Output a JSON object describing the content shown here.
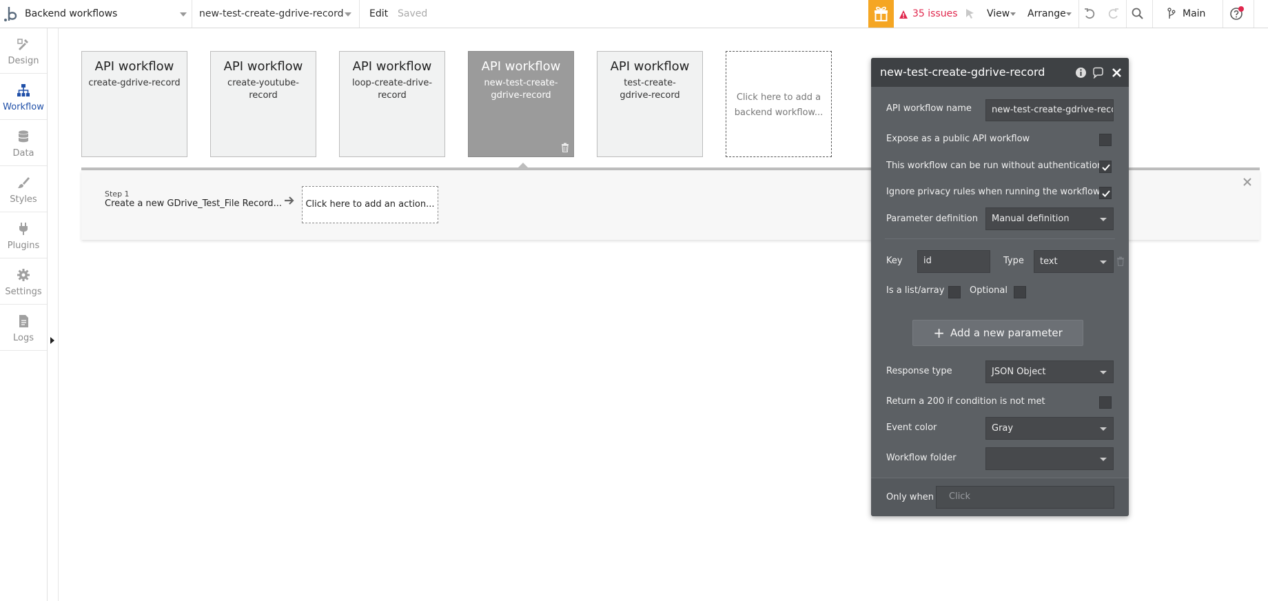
{
  "topbar": {
    "page_select": "Backend workflows",
    "workflow_select": "new-test-create-gdrive-record",
    "edit_label": "Edit",
    "saved_label": "Saved",
    "issues": "35 issues",
    "view": "View",
    "arrange": "Arrange",
    "branch": "Main",
    "accent_orange": "#f5a623",
    "issues_color": "#e0274d"
  },
  "rail": {
    "items": [
      {
        "label": "Design",
        "icon": "design-icon"
      },
      {
        "label": "Workflow",
        "icon": "workflow-icon"
      },
      {
        "label": "Data",
        "icon": "database-icon"
      },
      {
        "label": "Styles",
        "icon": "brush-icon"
      },
      {
        "label": "Plugins",
        "icon": "plug-icon"
      },
      {
        "label": "Settings",
        "icon": "gear-icon"
      },
      {
        "label": "Logs",
        "icon": "document-icon"
      }
    ],
    "active": "Workflow",
    "active_color": "#1f4fa8"
  },
  "cards": [
    {
      "title": "API workflow",
      "name": "create-gdrive-record"
    },
    {
      "title": "API workflow",
      "name": "create-youtube-record"
    },
    {
      "title": "API workflow",
      "name": "loop-create-drive-record"
    },
    {
      "title": "API workflow",
      "name": "new-test-create-gdrive-record",
      "selected": true
    },
    {
      "title": "API workflow",
      "name": "test-create-gdrive-record"
    }
  ],
  "add_card": "Click here to add a backend workflow...",
  "step": {
    "number": "Step 1",
    "text": "Create a new GDrive_Test_File Record...",
    "add_action": "Click here to add an action..."
  },
  "panel": {
    "title": "new-test-create-gdrive-record",
    "name_label": "API workflow name",
    "name_value": "new-test-create-gdrive-record",
    "expose_label": "Expose as a public API workflow",
    "expose_checked": false,
    "no_auth_label": "This workflow can be run without authentication",
    "no_auth_checked": true,
    "ignore_privacy_label": "Ignore privacy rules when running the workflow",
    "ignore_privacy_checked": true,
    "param_def_label": "Parameter definition",
    "param_def_value": "Manual definition",
    "key_label": "Key",
    "key_value": "id",
    "type_label": "Type",
    "type_value": "text",
    "is_list_label": "Is a list/array",
    "optional_label": "Optional",
    "add_param_label": "Add a new parameter",
    "response_type_label": "Response type",
    "response_type_value": "JSON Object",
    "return_200_label": "Return a 200 if condition is not met",
    "event_color_label": "Event color",
    "event_color_value": "Gray",
    "workflow_folder_label": "Workflow folder",
    "workflow_folder_value": "",
    "only_when_label": "Only when",
    "only_when_placeholder": "Click"
  }
}
